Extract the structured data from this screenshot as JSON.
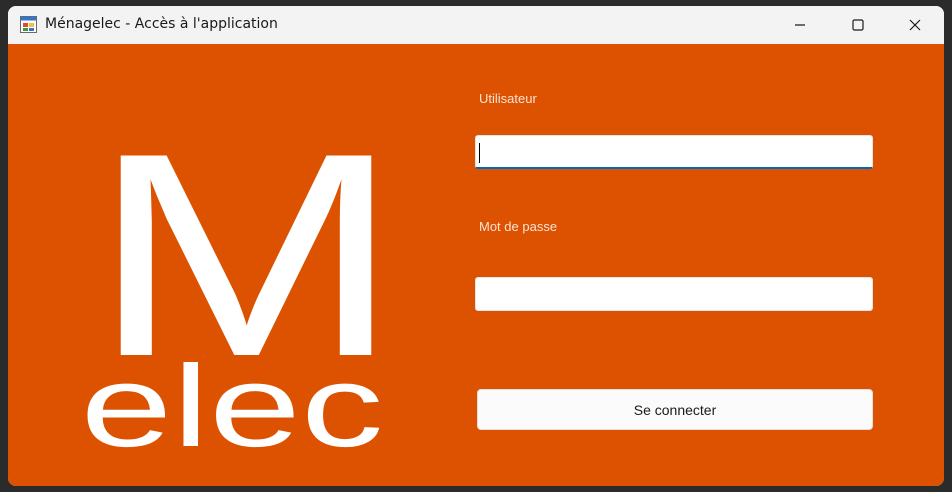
{
  "window": {
    "title": "Ménagelec - Accès à l'application"
  },
  "title_controls": {
    "minimize_icon": "minimize-icon",
    "maximize_icon": "maximize-icon",
    "close_icon": "close-icon"
  },
  "logo": {
    "letter": "M",
    "word": "elec",
    "color": "#ffffff"
  },
  "form": {
    "username_label": "Utilisateur",
    "username_value": "",
    "password_label": "Mot de passe",
    "password_value": "",
    "submit_label": "Se connecter"
  },
  "colors": {
    "background": "#dd5200",
    "focus_underline": "#0067c0"
  }
}
